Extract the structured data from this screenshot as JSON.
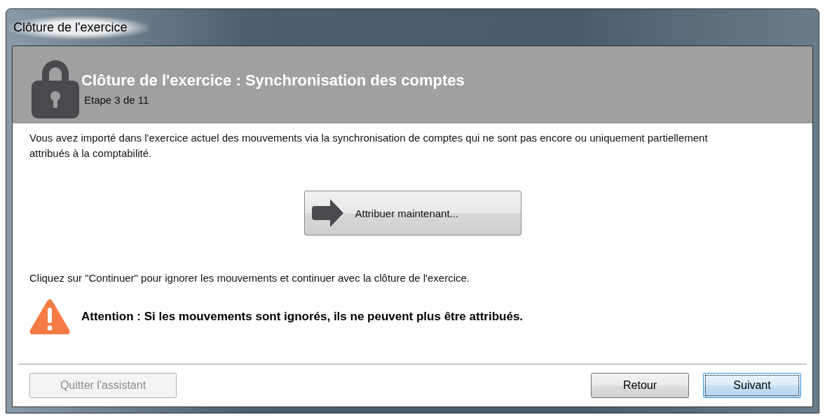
{
  "window": {
    "title": "Clôture de l'exercice"
  },
  "header": {
    "title": "Clôture de l'exercice : Synchronisation des comptes",
    "step": "Etape 3 de 11"
  },
  "intro": "Vous avez importé dans l'exercice actuel des mouvements via la synchronisation de comptes qui ne sont pas encore ou uniquement partiellement attribués à la comptabilité.",
  "action_button": {
    "label": "Attribuer maintenant..."
  },
  "instruction": "Cliquez sur \"Continuer\" pour ignorer les mouvements et continuer avec la clôture de l'exercice.",
  "warning": "Attention : Si les mouvements sont ignorés, ils ne peuvent plus être attribués.",
  "footer": {
    "left_buttons": [
      {
        "label": "Quitter l'assistant",
        "disabled": true,
        "focused": false
      }
    ],
    "right_buttons": [
      {
        "label": "Retour",
        "disabled": false,
        "focused": false
      },
      {
        "label": "Suivant",
        "disabled": false,
        "focused": true
      }
    ]
  }
}
